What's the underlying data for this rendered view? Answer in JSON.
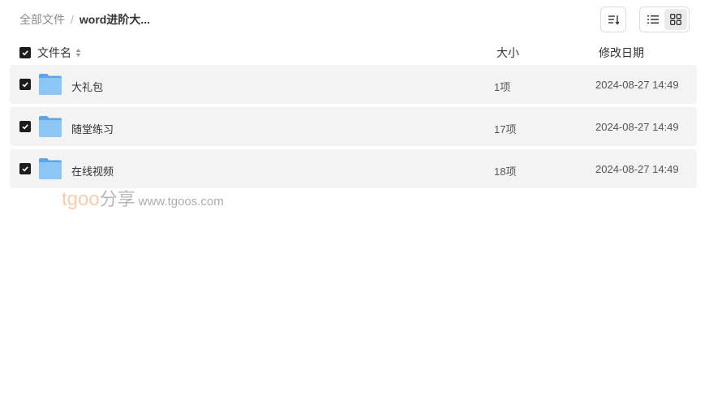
{
  "breadcrumb": {
    "root": "全部文件",
    "separator": "/",
    "current": "word进阶大..."
  },
  "toolbar": {
    "sort_icon": "sort-icon",
    "list_view_icon": "list-view-icon",
    "grid_view_icon": "grid-view-icon",
    "active_view": "list"
  },
  "table": {
    "headers": {
      "name": "文件名",
      "size": "大小",
      "date": "修改日期"
    },
    "rows": [
      {
        "name": "大礼包",
        "size": "1项",
        "date": "2024-08-27 14:49",
        "checked": true,
        "icon": "folder-icon"
      },
      {
        "name": "随堂练习",
        "size": "17项",
        "date": "2024-08-27 14:49",
        "checked": true,
        "icon": "folder-icon"
      },
      {
        "name": "在线视频",
        "size": "18项",
        "date": "2024-08-27 14:49",
        "checked": true,
        "icon": "folder-icon"
      }
    ]
  },
  "watermark": {
    "brand": "tgoo",
    "share": "分享",
    "url": "www.tgoos.com"
  },
  "colors": {
    "folder": "#7fbdf2",
    "checkbox": "#1c1c1c",
    "row_bg": "#f3f3f3",
    "watermark_brand": "#f5b98a"
  }
}
